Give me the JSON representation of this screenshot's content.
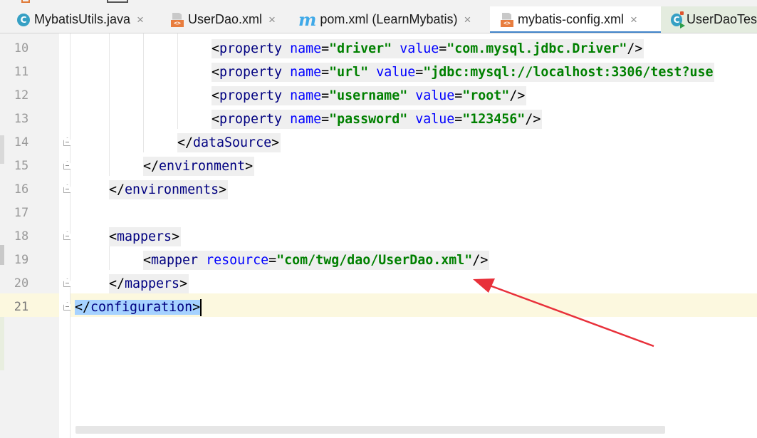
{
  "tabs": [
    {
      "label": "MybatisUtils.java",
      "icon": "java-class-icon",
      "closable": true,
      "active": false
    },
    {
      "label": "UserDao.xml",
      "icon": "xml-file-icon",
      "closable": true,
      "active": false
    },
    {
      "label": "pom.xml (LearnMybatis)",
      "icon": "maven-icon",
      "closable": true,
      "active": false
    },
    {
      "label": "mybatis-config.xml",
      "icon": "xml-file-icon",
      "closable": true,
      "active": true
    },
    {
      "label": "UserDaoTes",
      "icon": "java-test-class-icon",
      "closable": false,
      "active": false
    }
  ],
  "tab_close_glyph": "×",
  "editor": {
    "current_line": 21,
    "line_numbers": [
      "10",
      "11",
      "12",
      "13",
      "14",
      "15",
      "16",
      "17",
      "18",
      "19",
      "20",
      "21"
    ],
    "lines": [
      {
        "lt1": "<",
        "tag": "property",
        "a1": "name",
        "eq1": "=",
        "v1": "\"driver\"",
        "a2": "value",
        "eq2": "=",
        "v2": "\"com.mysql.jdbc.Driver\"",
        "end": "/>"
      },
      {
        "lt1": "<",
        "tag": "property",
        "a1": "name",
        "eq1": "=",
        "v1": "\"url\"",
        "a2": "value",
        "eq2": "=",
        "v2": "\"jdbc:mysql://localhost:3306/test?use",
        "end": ""
      },
      {
        "lt1": "<",
        "tag": "property",
        "a1": "name",
        "eq1": "=",
        "v1": "\"username\"",
        "a2": "value",
        "eq2": "=",
        "v2": "\"root\"",
        "end": "/>"
      },
      {
        "lt1": "<",
        "tag": "property",
        "a1": "name",
        "eq1": "=",
        "v1": "\"password\"",
        "a2": "value",
        "eq2": "=",
        "v2": "\"123456\"",
        "end": "/>"
      },
      {
        "open": "</",
        "tag": "dataSource",
        "close": ">"
      },
      {
        "open": "</",
        "tag": "environment",
        "close": ">"
      },
      {
        "open": "</",
        "tag": "environments",
        "close": ">"
      },
      {},
      {
        "open": "<",
        "tag": "mappers",
        "close": ">"
      },
      {
        "lt1": "<",
        "tag": "mapper",
        "a1": "resource",
        "eq1": "=",
        "v1": "\"com/twg/dao/UserDao.xml\"",
        "end": "/>"
      },
      {
        "open": "</",
        "tag": "mappers",
        "close": ">"
      },
      {
        "open": "</",
        "tag": "configuration",
        "close": ">"
      }
    ]
  },
  "colors": {
    "tag": "#000080",
    "attribute": "#0000ff",
    "string": "#008000",
    "annotation_arrow": "#e8303a",
    "current_line": "#fcf8df",
    "selection": "#a6d2ff"
  }
}
